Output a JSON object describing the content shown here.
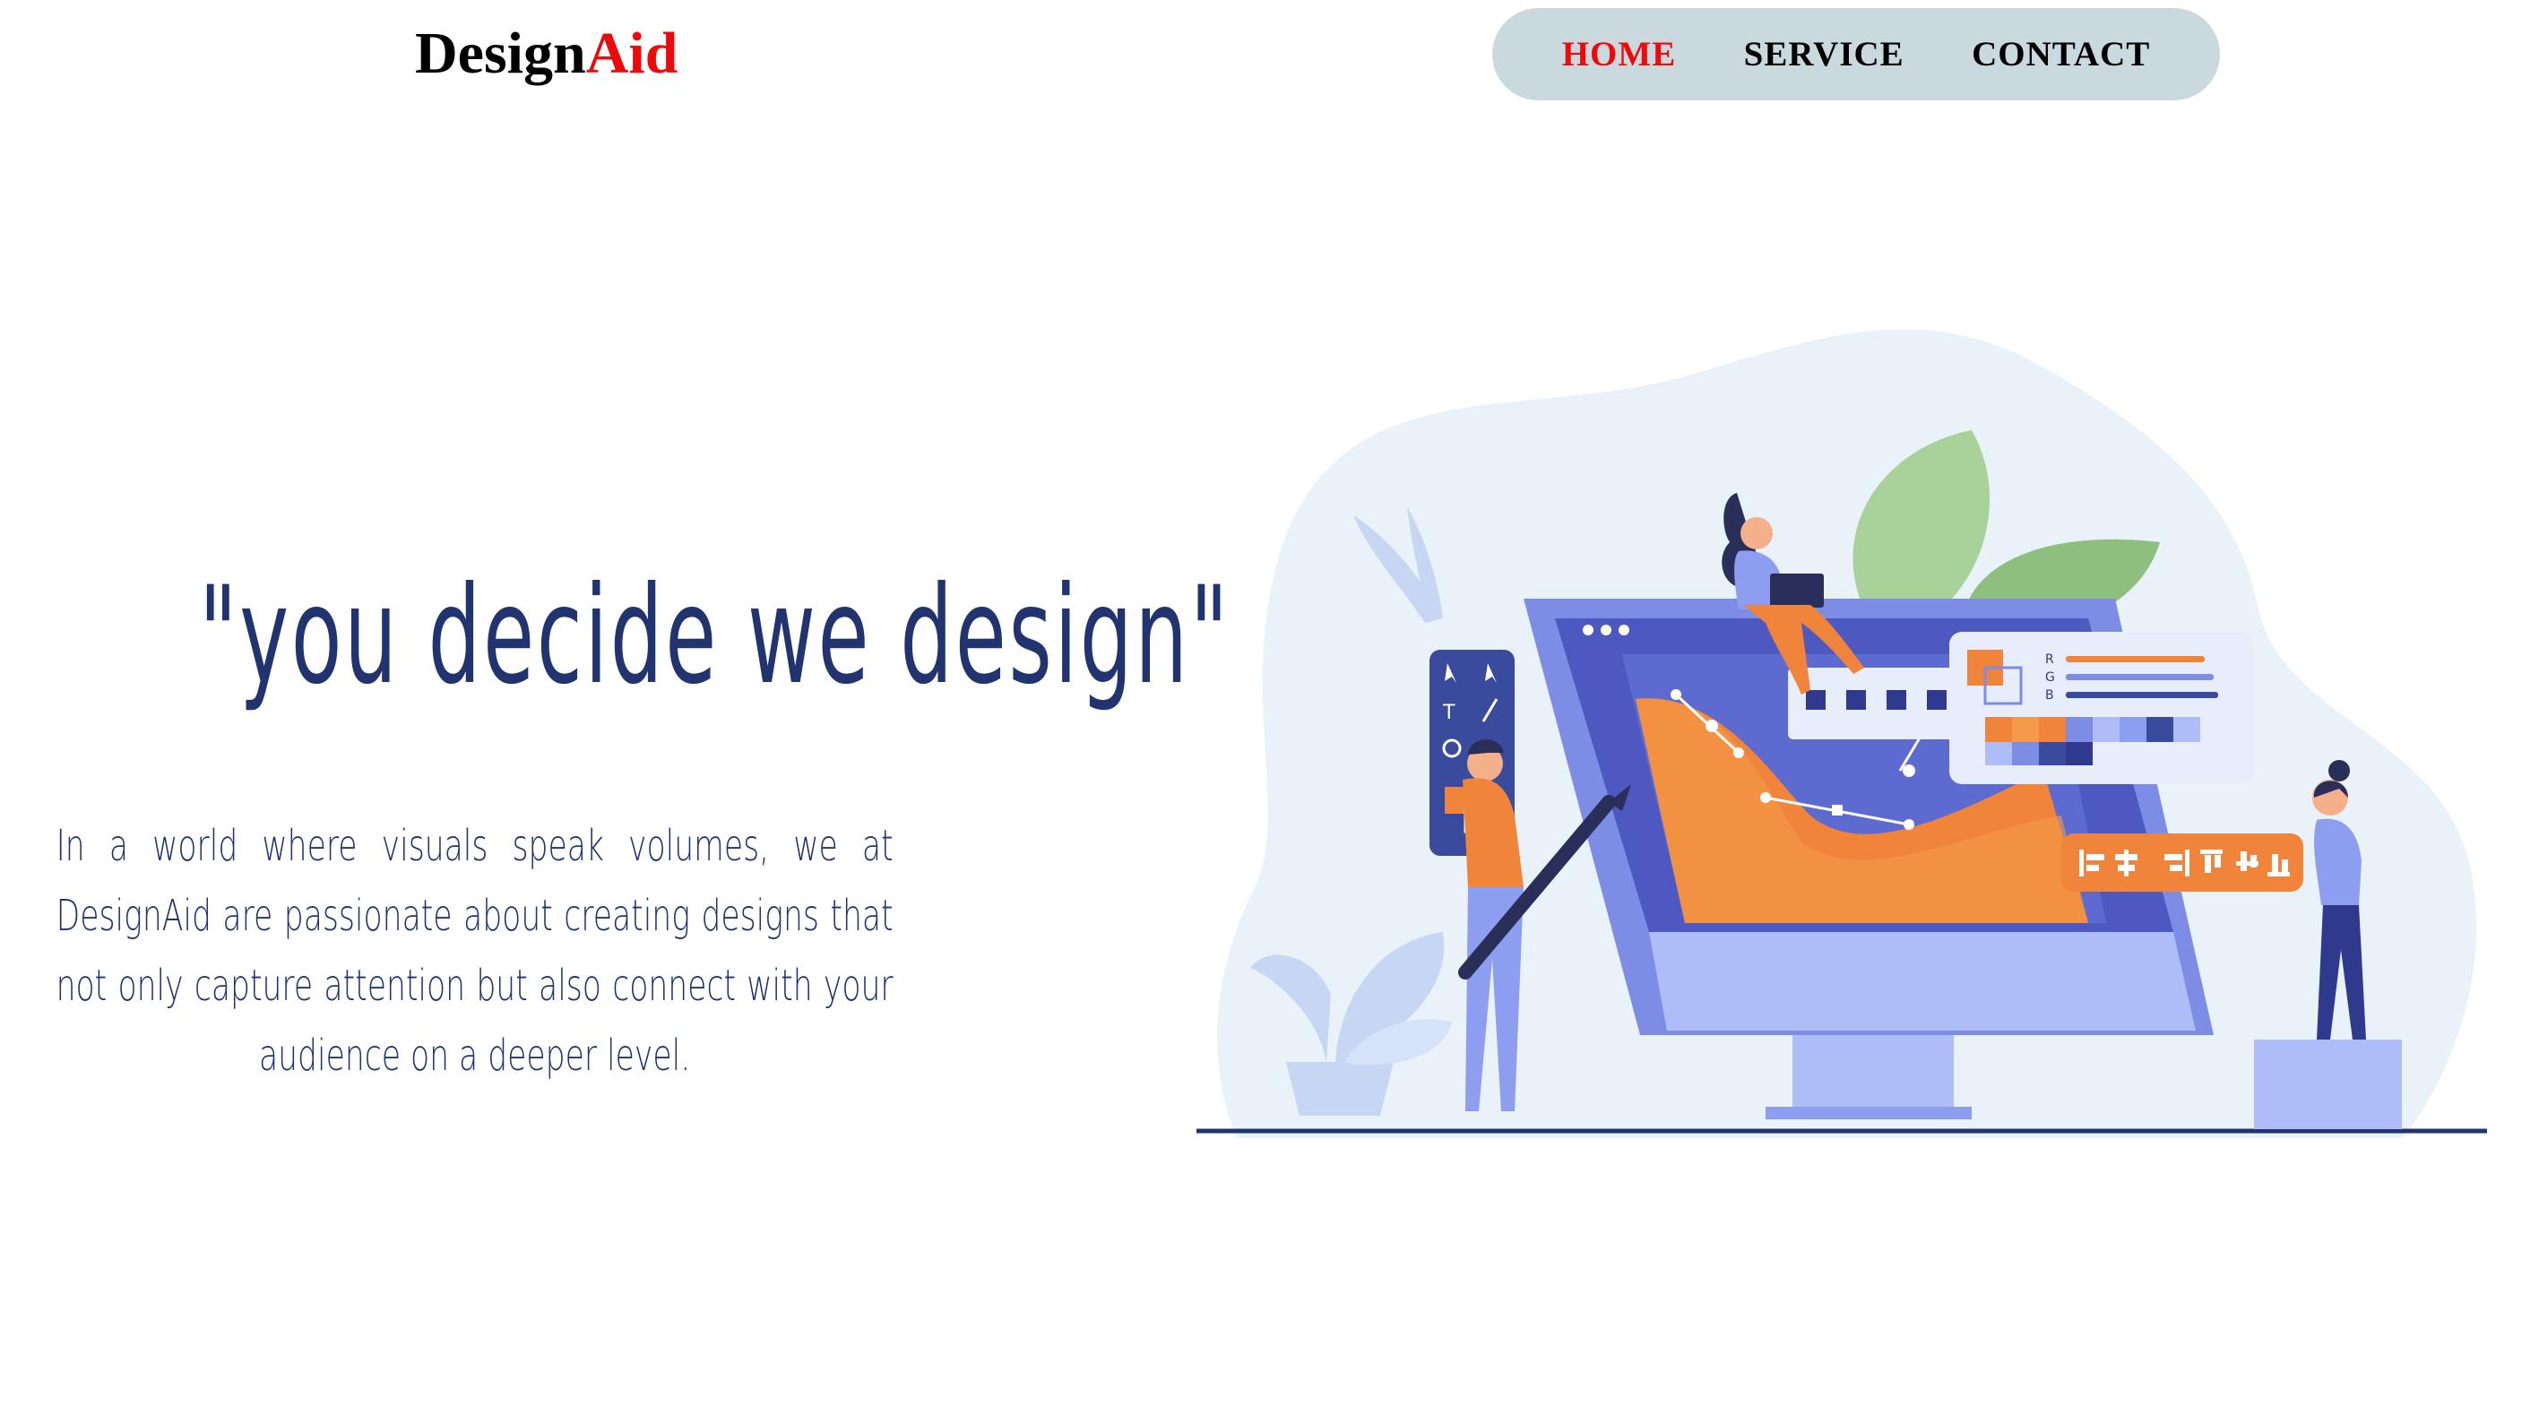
{
  "header": {
    "logo_main": "Design",
    "logo_accent": "Aid"
  },
  "nav": {
    "items": [
      {
        "label": "HOME",
        "active": true
      },
      {
        "label": "SERVICE",
        "active": false
      },
      {
        "label": "CONTACT",
        "active": false
      }
    ]
  },
  "hero": {
    "headline": "\"you decide we design\"",
    "description": "In a world where visuals speak volumes, we at DesignAid are passionate about creating designs that not only capture attention but also connect with your audience on a deeper level."
  },
  "illustration": {
    "rgb_labels": [
      "R",
      "G",
      "B"
    ]
  },
  "colors": {
    "accent_red": "#ee0a0a",
    "nav_bg": "#cad9de",
    "text_navy": "#223470"
  }
}
